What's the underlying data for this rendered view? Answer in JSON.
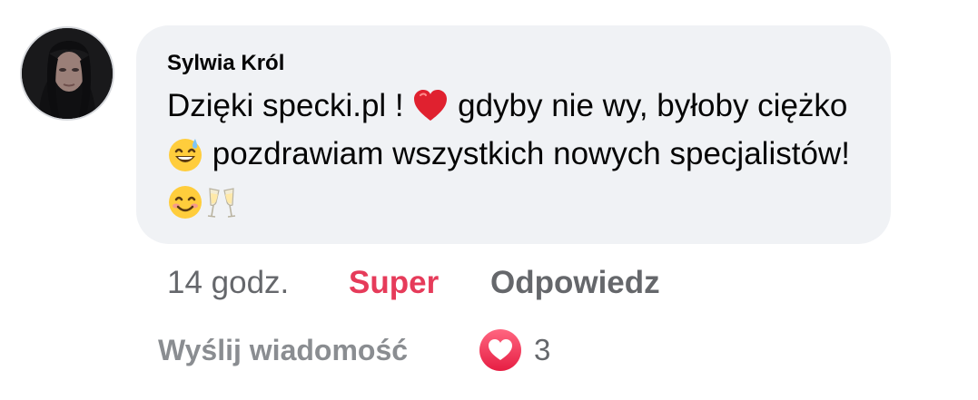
{
  "comment": {
    "author": "Sylwia Król",
    "text_parts": [
      "Dzięki specki.pl ! ",
      " gdyby nie wy, byłoby ciężko ",
      " pozdrawiam wszystkich nowych specjalistów! "
    ],
    "emoji_names": [
      "heart-emoji",
      "grinning-sweat-emoji",
      "smiling-emoji",
      "champagne-glasses-emoji"
    ]
  },
  "actions": {
    "time": "14 godz.",
    "like_label": "Super",
    "reply_label": "Odpowiedz"
  },
  "footer": {
    "message_label": "Wyślij wiadomość",
    "reaction_count": "3",
    "reaction_icon": "heart-reaction-icon"
  },
  "colors": {
    "bubble": "#f0f2f5",
    "like_active": "#e63b5a",
    "muted_text": "#65676b",
    "heart": "#f33e58"
  }
}
